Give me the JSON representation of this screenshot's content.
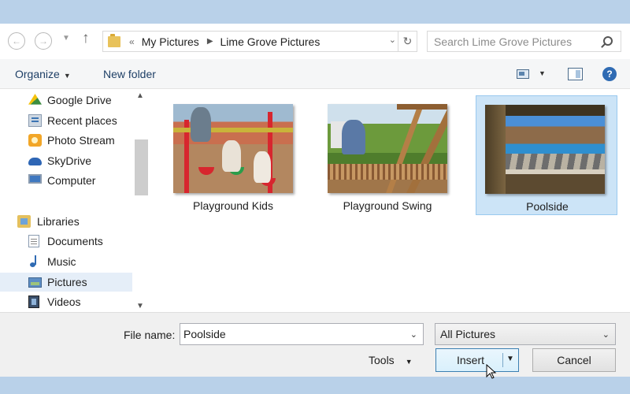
{
  "address": {
    "chevrons": "«",
    "crumbs": [
      "My Pictures",
      "Lime Grove Pictures"
    ]
  },
  "search": {
    "placeholder": "Search Lime Grove Pictures"
  },
  "toolbar": {
    "organize_label": "Organize",
    "new_folder_label": "New folder",
    "help_glyph": "?"
  },
  "nav": {
    "favorites": [
      {
        "label": "Google Drive",
        "icon": "google-drive-icon"
      },
      {
        "label": "Recent places",
        "icon": "recent-places-icon"
      },
      {
        "label": "Photo Stream",
        "icon": "photo-stream-icon"
      },
      {
        "label": "SkyDrive",
        "icon": "skydrive-icon"
      },
      {
        "label": "Computer",
        "icon": "computer-icon"
      }
    ],
    "libraries": {
      "label": "Libraries",
      "items": [
        {
          "label": "Documents",
          "icon": "documents-icon"
        },
        {
          "label": "Music",
          "icon": "music-icon"
        },
        {
          "label": "Pictures",
          "icon": "pictures-icon",
          "selected": true
        },
        {
          "label": "Videos",
          "icon": "videos-icon"
        }
      ]
    }
  },
  "files": [
    {
      "name": "Playground Kids",
      "selected": false
    },
    {
      "name": "Playground Swing",
      "selected": false
    },
    {
      "name": "Poolside",
      "selected": true
    }
  ],
  "bottom": {
    "file_name_label": "File name:",
    "file_name_value": "Poolside",
    "file_type": "All Pictures",
    "tools_label": "Tools",
    "insert_label": "Insert",
    "cancel_label": "Cancel"
  },
  "colors": {
    "frame": "#b9d1e9",
    "selection": "#cce4f7",
    "accent": "#2f6bb3"
  }
}
